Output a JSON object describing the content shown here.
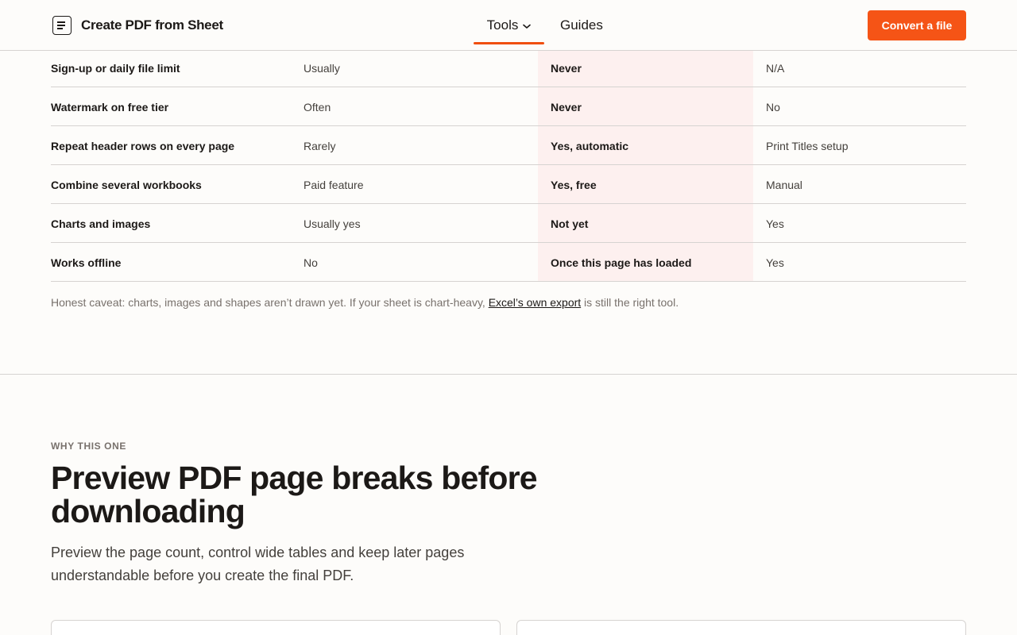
{
  "header": {
    "brand": "Create PDF from Sheet",
    "nav": {
      "tools": "Tools",
      "guides": "Guides"
    },
    "cta": "Convert a file"
  },
  "comparison": {
    "rows": [
      {
        "feature": "Sign-up or daily file limit",
        "col1": "Usually",
        "col2": "Never",
        "col3": "N/A"
      },
      {
        "feature": "Watermark on free tier",
        "col1": "Often",
        "col2": "Never",
        "col3": "No"
      },
      {
        "feature": "Repeat header rows on every page",
        "col1": "Rarely",
        "col2": "Yes, automatic",
        "col3": "Print Titles setup"
      },
      {
        "feature": "Combine several workbooks",
        "col1": "Paid feature",
        "col2": "Yes, free",
        "col3": "Manual"
      },
      {
        "feature": "Charts and images",
        "col1": "Usually yes",
        "col2": "Not yet",
        "col3": "Yes"
      },
      {
        "feature": "Works offline",
        "col1": "No",
        "col2": "Once this page has loaded",
        "col3": "Yes"
      }
    ],
    "highlight_color": "#fdf0ef"
  },
  "caveat": {
    "before": "Honest caveat: charts, images and shapes aren’t drawn yet. If your sheet is chart-heavy,",
    "link": "Excel’s own export",
    "after": "is still the right tool."
  },
  "section": {
    "eyebrow": "WHY THIS ONE",
    "title": "Preview PDF page breaks before downloading",
    "lead": "Preview the page count, control wide tables and keep later pages understandable before you create the final PDF."
  },
  "colors": {
    "accent": "#f55416",
    "text": "#1c1917",
    "muted": "#78716c"
  },
  "icons": {
    "brand": "document-icon",
    "tools_menu": "chevron-down-icon"
  }
}
